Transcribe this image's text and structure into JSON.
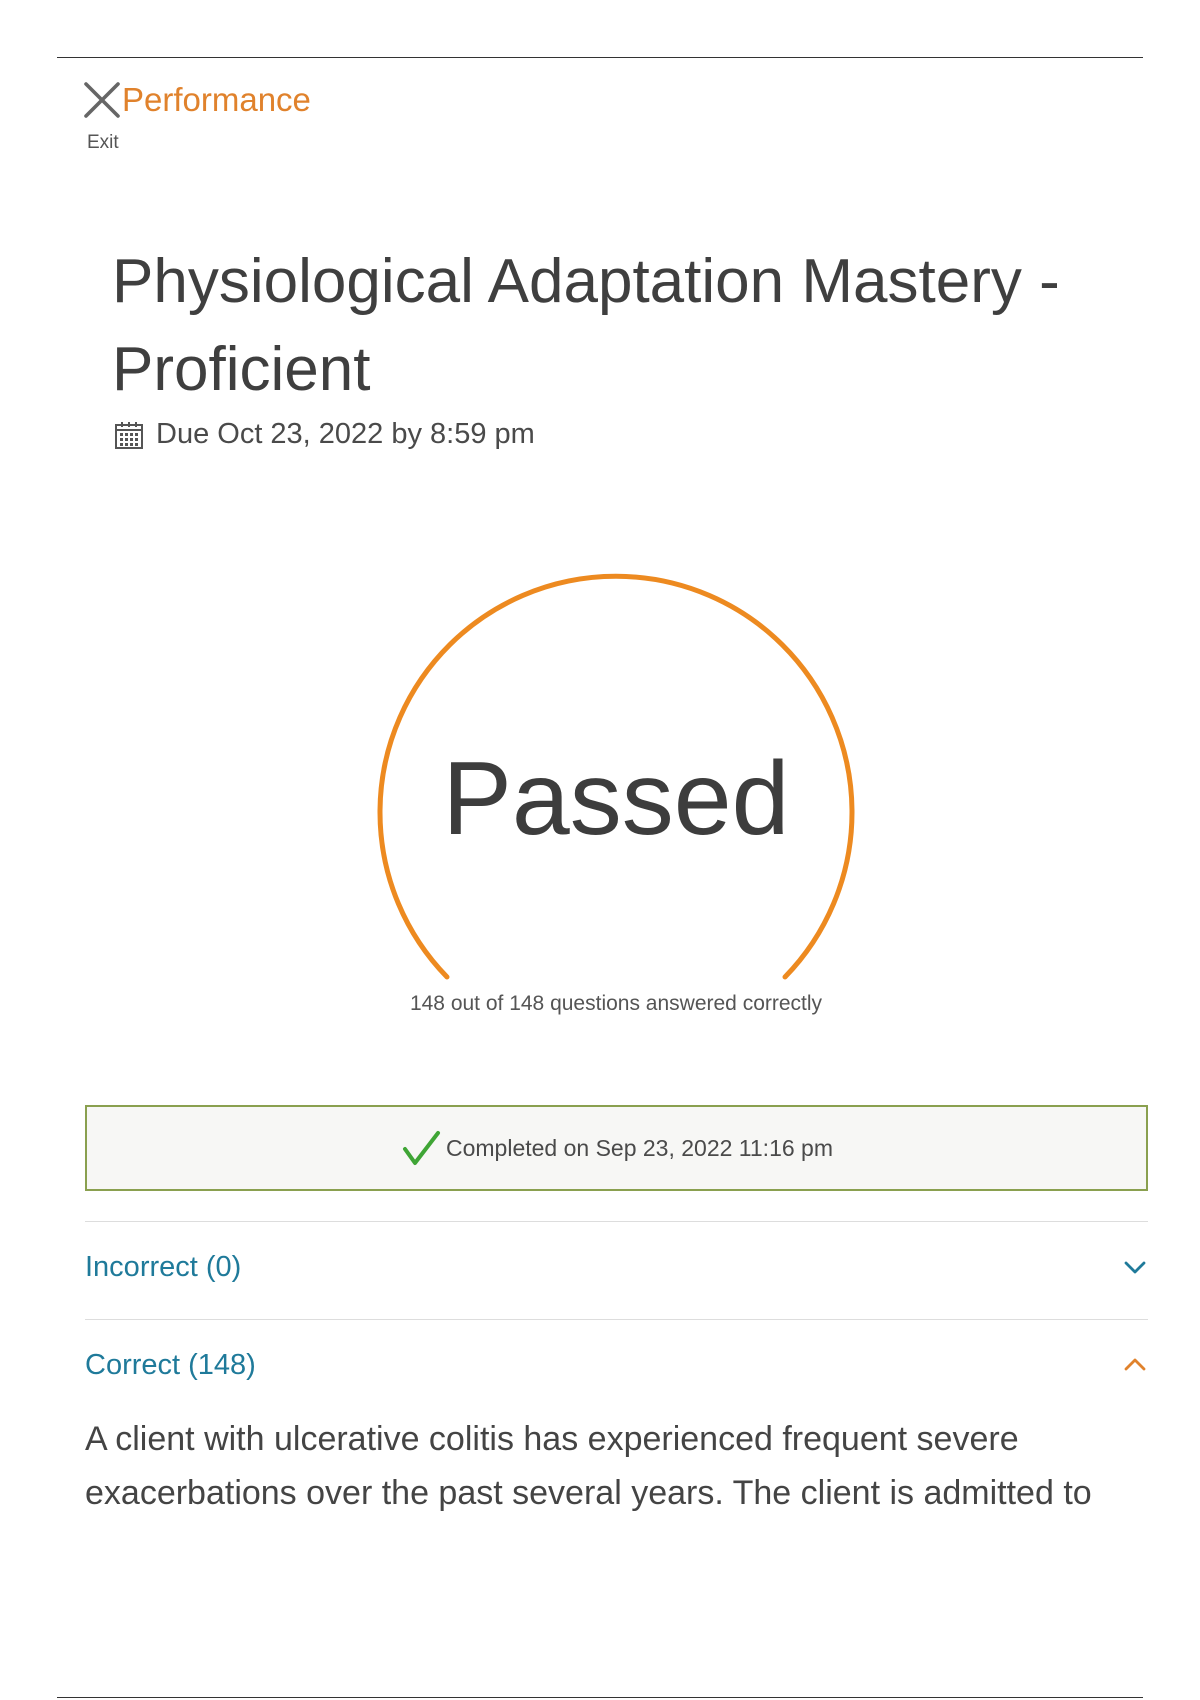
{
  "header": {
    "app_title": "Performance",
    "exit_label": "Exit"
  },
  "assignment": {
    "title": "Physiological Adaptation Mastery - Proficient",
    "due_text": "Due Oct 23, 2022 by 8:59 pm"
  },
  "result": {
    "status": "Passed",
    "summary": "148 out of 148 questions answered correctly",
    "correct": 148,
    "total": 148
  },
  "completion": {
    "text": "Completed on Sep 23, 2022 11:16 pm"
  },
  "sections": [
    {
      "label": "Incorrect (0)",
      "expanded": false
    },
    {
      "label": "Correct (148)",
      "expanded": true
    }
  ],
  "question_preview": {
    "text": "A client with ulcerative colitis has experienced frequent severe exacerbations over the past several years. The client is admitted to"
  },
  "icons": {
    "close": "close-icon",
    "calendar": "calendar-icon",
    "check": "check-icon",
    "chevron_down": "chevron-down-icon",
    "chevron_up": "chevron-up-icon"
  },
  "colors": {
    "accent_orange": "#e0822c",
    "link_teal": "#1f7a9a",
    "success_green": "#3fa535",
    "box_border": "#8aa04f"
  }
}
